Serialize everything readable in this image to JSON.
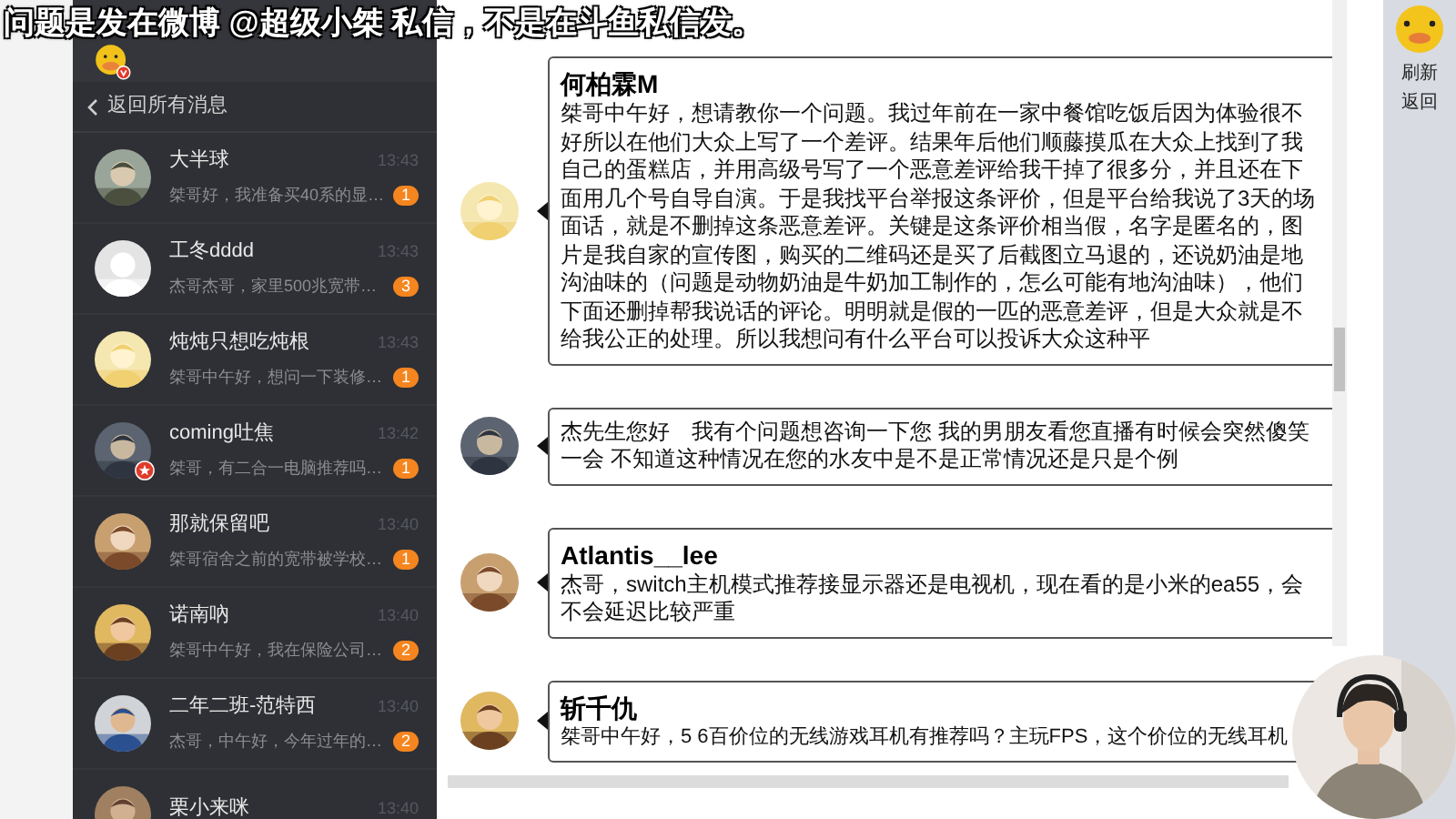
{
  "caption": "问题是发在微博 @超级小桀 私信，不是在斗鱼私信发。",
  "sidebar": {
    "back_label": "返回所有消息",
    "conversations": [
      {
        "name": "大半球",
        "preview": "桀哥好，我准备买40系的显…",
        "time": "13:43",
        "unread": "1",
        "verified": false
      },
      {
        "name": "工冬dddd",
        "preview": "杰哥杰哥，家里500兆宽带…",
        "time": "13:43",
        "unread": "3",
        "verified": false
      },
      {
        "name": "炖炖只想吃炖根",
        "preview": "桀哥中午好，想问一下装修…",
        "time": "13:43",
        "unread": "1",
        "verified": false
      },
      {
        "name": "coming吐焦",
        "preview": "桀哥，有二合一电脑推荐吗…",
        "time": "13:42",
        "unread": "1",
        "verified": true
      },
      {
        "name": "那就保留吧",
        "preview": "桀哥宿舍之前的宽带被学校…",
        "time": "13:40",
        "unread": "1",
        "verified": false
      },
      {
        "name": "诺南吶",
        "preview": "桀哥中午好，我在保险公司…",
        "time": "13:40",
        "unread": "2",
        "verified": false
      },
      {
        "name": "二年二班-范特西",
        "preview": "杰哥，中午好，今年过年的…",
        "time": "13:40",
        "unread": "2",
        "verified": false
      },
      {
        "name": "栗小来咪",
        "time": "13:40",
        "verified": false
      }
    ]
  },
  "messages": [
    {
      "sender": "何柏霖M",
      "text": "桀哥中午好，想请教你一个问题。我过年前在一家中餐馆吃饭后因为体验很不好所以在他们大众上写了一个差评。结果年后他们顺藤摸瓜在大众上找到了我自己的蛋糕店，并用高级号写了一个恶意差评给我干掉了很多分，并且还在下面用几个号自导自演。于是我找平台举报这条评价，但是平台给我说了3天的场面话，就是不删掉这条恶意差评。关键是这条评价相当假，名字是匿名的，图片是我自家的宣传图，购买的二维码还是买了后截图立马退的，还说奶油是地沟油味的（问题是动物奶油是牛奶加工制作的，怎么可能有地沟油味），他们下面还删掉帮我说话的评论。明明就是假的一匹的恶意差评，但是大众就是不给我公正的处理。所以我想问有什么平台可以投诉大众这种平"
    },
    {
      "text": "杰先生您好　我有个问题想咨询一下您  我的男朋友看您直播有时候会突然傻笑一会  不知道这种情况在您的水友中是不是正常情况还是只是个例"
    },
    {
      "sender": "Atlantis__lee",
      "text": "杰哥，switch主机模式推荐接显示器还是电视机，现在看的是小米的ea55，会不会延迟比较严重"
    },
    {
      "sender": "斩千仇",
      "text": "桀哥中午好，5 6百价位的无线游戏耳机有推荐吗？主玩FPS，这个价位的无线耳机"
    }
  ],
  "side_panel": {
    "buttons": [
      "刷新",
      "返回"
    ]
  }
}
